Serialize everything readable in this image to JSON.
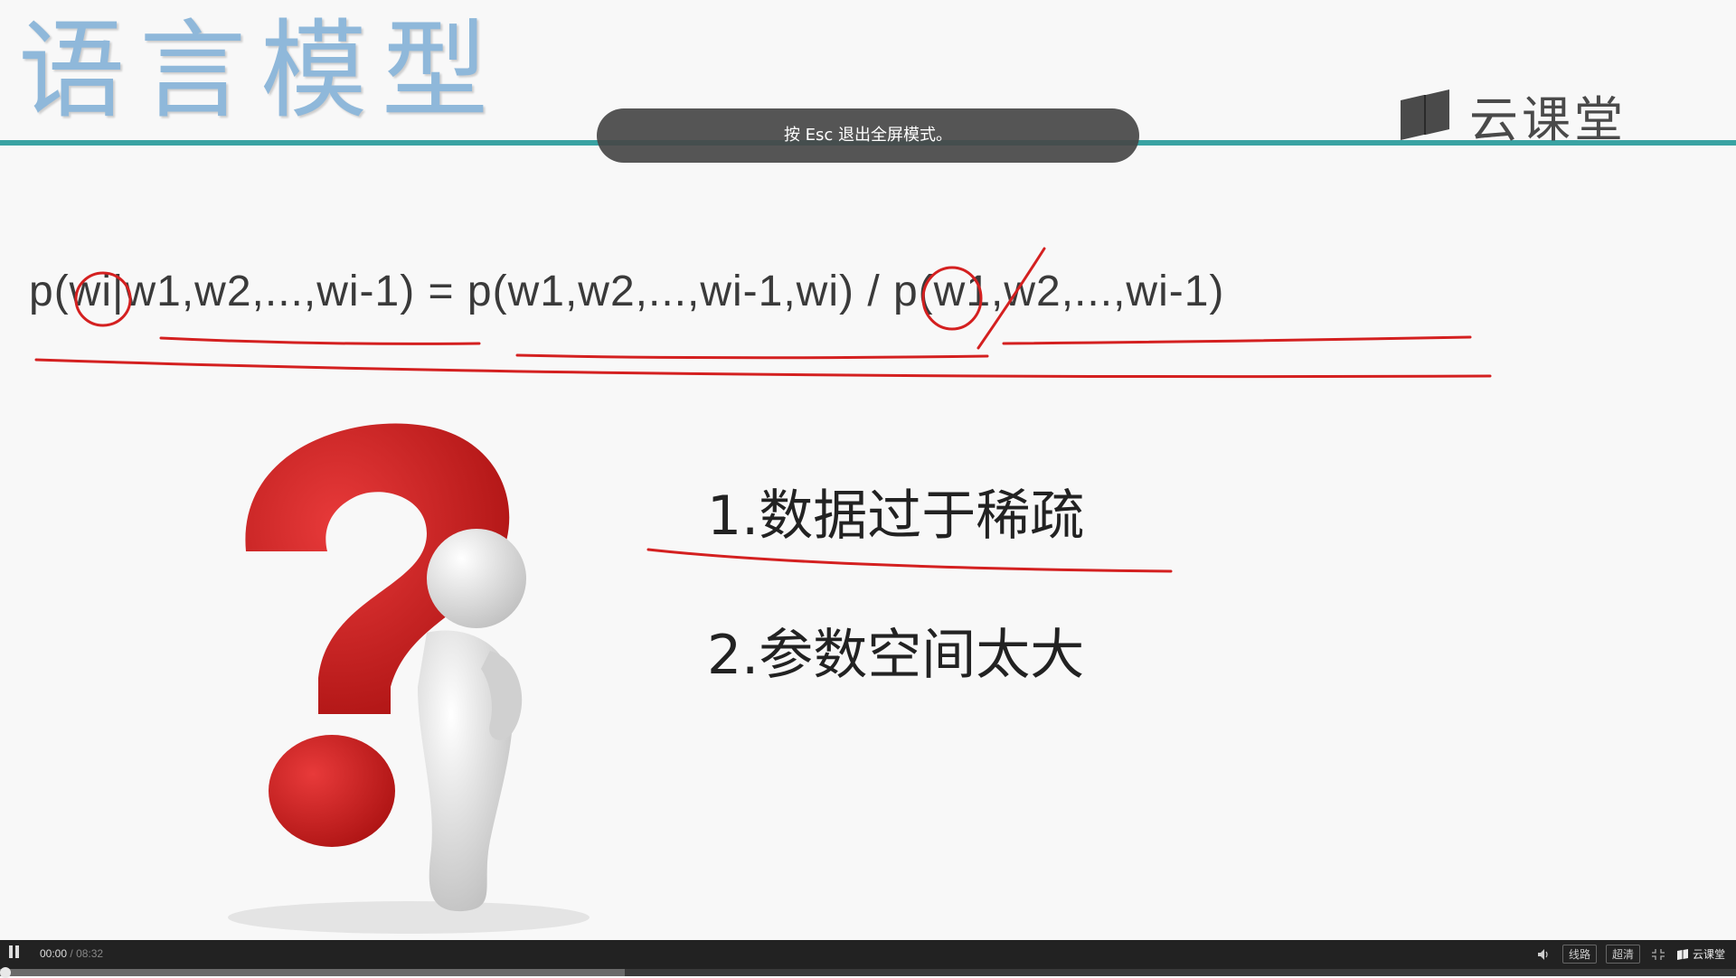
{
  "slide": {
    "title": "语言模型",
    "brand_name": "云课堂",
    "formula": "p(wi|w1,w2,...,wi-1) = p(w1,w2,...,wi-1,wi) / p(w1,w2,...,wi-1)",
    "points": [
      "1.数据过于稀疏",
      "2.参数空间太大"
    ]
  },
  "toast": {
    "text": "按 Esc 退出全屏模式。"
  },
  "player": {
    "current_time": "00:00",
    "separator": "/",
    "duration": "08:32",
    "progress_fraction": 0.0,
    "buffered_fraction": 0.36,
    "line_label": "线路",
    "quality_label": "超清",
    "brand_label": "云课堂"
  },
  "colors": {
    "teal_rule": "#3aa3a3",
    "annotation_red": "#d42020",
    "title_blue": "#8fb8da"
  }
}
